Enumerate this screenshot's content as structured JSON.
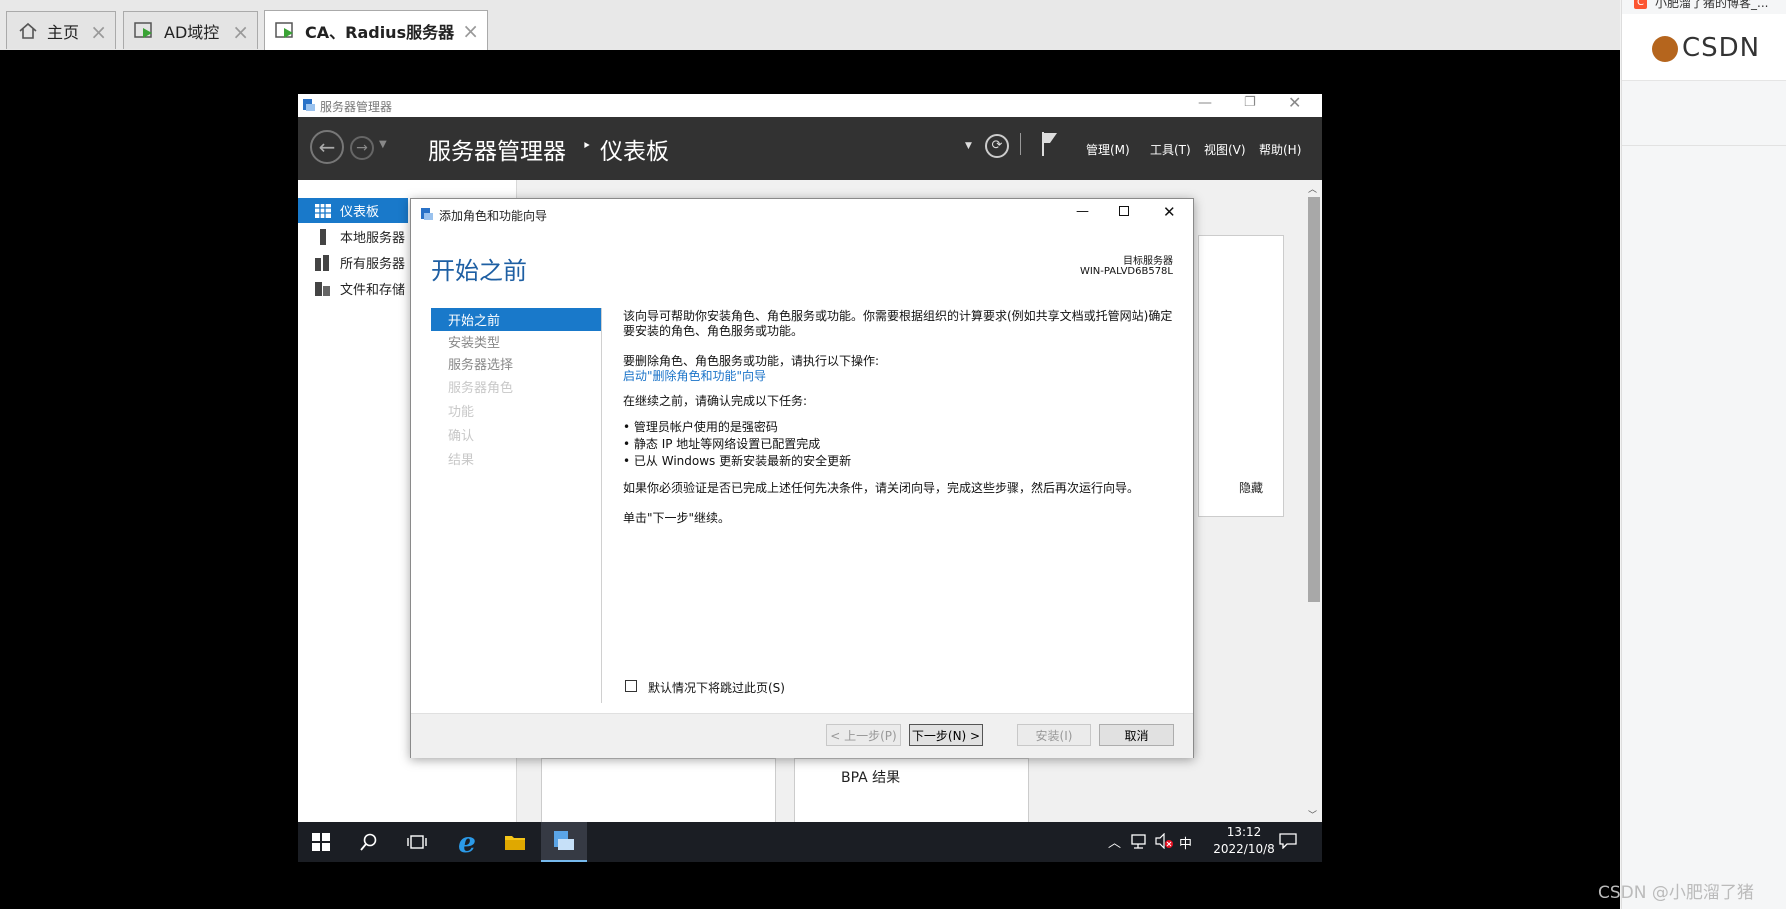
{
  "host_tabs": [
    {
      "label": "主页",
      "icon": "home-icon"
    },
    {
      "label": "AD域控",
      "icon": "vm-icon"
    },
    {
      "label": "CA、Radius服务器",
      "icon": "vm-icon"
    }
  ],
  "csdn": {
    "top_text": "小肥溜了猪的博客_...",
    "logo": "CSDN"
  },
  "watermark": "CSDN @小肥溜了猪",
  "server_manager": {
    "window_title": "服务器管理器",
    "breadcrumb_root": "服务器管理器",
    "breadcrumb_sep": "‣",
    "breadcrumb_page": "仪表板",
    "menu": [
      "管理(M)",
      "工具(T)",
      "视图(V)",
      "帮助(H)"
    ],
    "nav": [
      {
        "label": "仪表板",
        "icon": "dashboard-icon",
        "active": true
      },
      {
        "label": "本地服务器",
        "icon": "server-icon"
      },
      {
        "label": "所有服务器",
        "icon": "servers-icon"
      },
      {
        "label": "文件和存储",
        "icon": "storage-icon"
      }
    ],
    "hide_link": "隐藏",
    "bpa_label": "BPA 结果"
  },
  "wizard": {
    "title": "添加角色和功能向导",
    "heading": "开始之前",
    "target_label": "目标服务器",
    "target_name": "WIN-PALVD6B578L",
    "steps": [
      {
        "label": "开始之前",
        "state": "active"
      },
      {
        "label": "安装类型",
        "state": "enabled"
      },
      {
        "label": "服务器选择",
        "state": "enabled"
      },
      {
        "label": "服务器角色",
        "state": "disabled"
      },
      {
        "label": "功能",
        "state": "disabled"
      },
      {
        "label": "确认",
        "state": "disabled"
      },
      {
        "label": "结果",
        "state": "disabled"
      }
    ],
    "intro_line1": "该向导可帮助你安装角色、角色服务或功能。你需要根据组织的计算要求(例如共享文档或托管网站)确定",
    "intro_line2": "要安装的角色、角色服务或功能。",
    "remove_text": "要删除角色、角色服务或功能，请执行以下操作:",
    "remove_link": "启动\"删除角色和功能\"向导",
    "before_text": "在继续之前，请确认完成以下任务:",
    "bullets": [
      "管理员帐户使用的是强密码",
      "静态 IP 地址等网络设置已配置完成",
      "已从 Windows 更新安装最新的安全更新"
    ],
    "verify_text": "如果你必须验证是否已完成上述任何先决条件，请关闭向导，完成这些步骤，然后再次运行向导。",
    "next_hint": "单击\"下一步\"继续。",
    "skip_checkbox": "默认情况下将跳过此页(S)",
    "buttons": {
      "prev": "< 上一步(P)",
      "next": "下一步(N) >",
      "install": "安装(I)",
      "cancel": "取消"
    }
  },
  "taskbar": {
    "time": "13:12",
    "date": "2022/10/8",
    "ime": "中"
  },
  "colors": {
    "accent": "#1979ca",
    "heading_blue": "#1e5fa3",
    "link": "#1a73c8",
    "dark_header": "#323232",
    "taskbar": "#1b1e24"
  }
}
